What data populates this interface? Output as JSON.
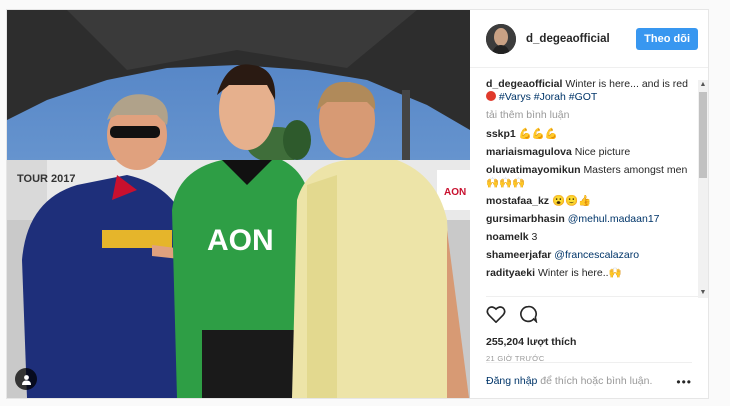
{
  "post": {
    "username": "d_degeaofficial",
    "follow_label": "Theo dõi",
    "caption": {
      "user": "d_degeaofficial",
      "text": "Winter is here... and is red",
      "emoji": "🔴",
      "tags": "#Varys #Jorah #GOT"
    },
    "load_more": "tải thêm bình luận",
    "comments": [
      {
        "user": "sskp1",
        "text": "💪💪💪"
      },
      {
        "user": "mariaismagulova",
        "text": "Nice picture"
      },
      {
        "user": "oluwatimayomikun",
        "text": "Masters amongst men",
        "text2": "🙌🙌🙌"
      },
      {
        "user": "mostafaa_kz",
        "text": "😮🙂👍"
      },
      {
        "user": "gursimarbhasin",
        "text": "@mehul.madaan17"
      },
      {
        "user": "noamelk",
        "text": "3"
      },
      {
        "user": "shameerjafar",
        "text": "@francescalazaro"
      },
      {
        "user": "radityaeki",
        "text": "Winter is here..🙌"
      }
    ],
    "likes": "255,204 lượt thích",
    "time": "21 GIỜ TRƯỚC",
    "login_link": "Đăng nhập",
    "login_text": " để thích hoặc bình luận.",
    "more": "•••"
  },
  "photo": {
    "shirt_text_left": "AON",
    "banner_text": "TOUR 2017"
  }
}
